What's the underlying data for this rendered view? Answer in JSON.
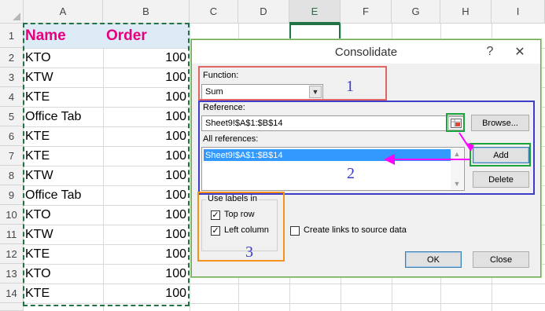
{
  "spreadsheet": {
    "columns": [
      "A",
      "B",
      "C",
      "D",
      "E",
      "F",
      "G",
      "H",
      "I"
    ],
    "active_column": "E",
    "header_row": {
      "name": "Name",
      "order": "Order"
    },
    "rows": [
      {
        "num": "1"
      },
      {
        "num": "2",
        "name": "KTO",
        "order": "100"
      },
      {
        "num": "3",
        "name": "KTW",
        "order": "100"
      },
      {
        "num": "4",
        "name": "KTE",
        "order": "100"
      },
      {
        "num": "5",
        "name": "Office Tab",
        "order": "100"
      },
      {
        "num": "6",
        "name": "KTE",
        "order": "100"
      },
      {
        "num": "7",
        "name": "KTE",
        "order": "100"
      },
      {
        "num": "8",
        "name": "KTW",
        "order": "100"
      },
      {
        "num": "9",
        "name": "Office Tab",
        "order": "100"
      },
      {
        "num": "10",
        "name": "KTO",
        "order": "100"
      },
      {
        "num": "11",
        "name": "KTW",
        "order": "100"
      },
      {
        "num": "12",
        "name": "KTE",
        "order": "100"
      },
      {
        "num": "13",
        "name": "KTO",
        "order": "100"
      },
      {
        "num": "14",
        "name": "KTE",
        "order": "100"
      }
    ]
  },
  "dialog": {
    "title": "Consolidate",
    "help": "?",
    "close": "✕",
    "function_label": "Function:",
    "function_value": "Sum",
    "reference_label": "Reference:",
    "reference_value": "Sheet9!$A$1:$B$14",
    "browse_label": "Browse...",
    "all_references_label": "All references:",
    "all_references": [
      "Sheet9!$A$1:$B$14"
    ],
    "add_label": "Add",
    "delete_label": "Delete",
    "use_labels_label": "Use labels in",
    "top_row_label": "Top row",
    "left_column_label": "Left column",
    "links_label": "Create links to source data",
    "ok_label": "OK",
    "close_label": "Close",
    "top_row_checked": true,
    "left_column_checked": true,
    "links_checked": false
  },
  "annotations": {
    "step1": "1",
    "step2": "2",
    "step3": "3"
  },
  "colors": {
    "header_text": "#e6007e",
    "annotation_blue": "#3a3ad0",
    "step1_box": "#e06666",
    "step2_box": "#3c3cc8",
    "step3_box": "#f6921e",
    "highlight_green": "#1aa33a",
    "arrow": "#ff00ff"
  }
}
